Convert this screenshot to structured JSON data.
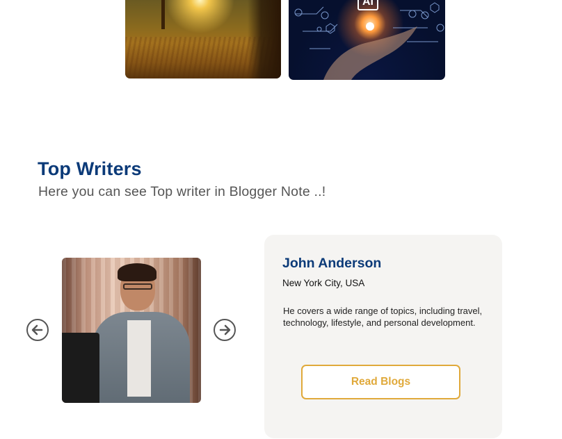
{
  "gallery": {
    "images": [
      {
        "subject": "sunset landscape"
      },
      {
        "subject": "ai hand",
        "badge": "AI"
      }
    ]
  },
  "section": {
    "title": "Top Writers",
    "subtitle": "Here you can see Top writer in Blogger Note ..!"
  },
  "carousel": {
    "prev_icon": "arrow-left-circle-icon",
    "next_icon": "arrow-right-circle-icon"
  },
  "writer": {
    "name": "John Anderson",
    "location": "New York City, USA",
    "bio": "He covers a wide range of topics, including travel, technology, lifestyle, and personal development.",
    "read_button": "Read Blogs"
  },
  "colors": {
    "title": "#0b3a78",
    "accent": "#e0a93a",
    "card_bg": "#f5f4f2"
  }
}
